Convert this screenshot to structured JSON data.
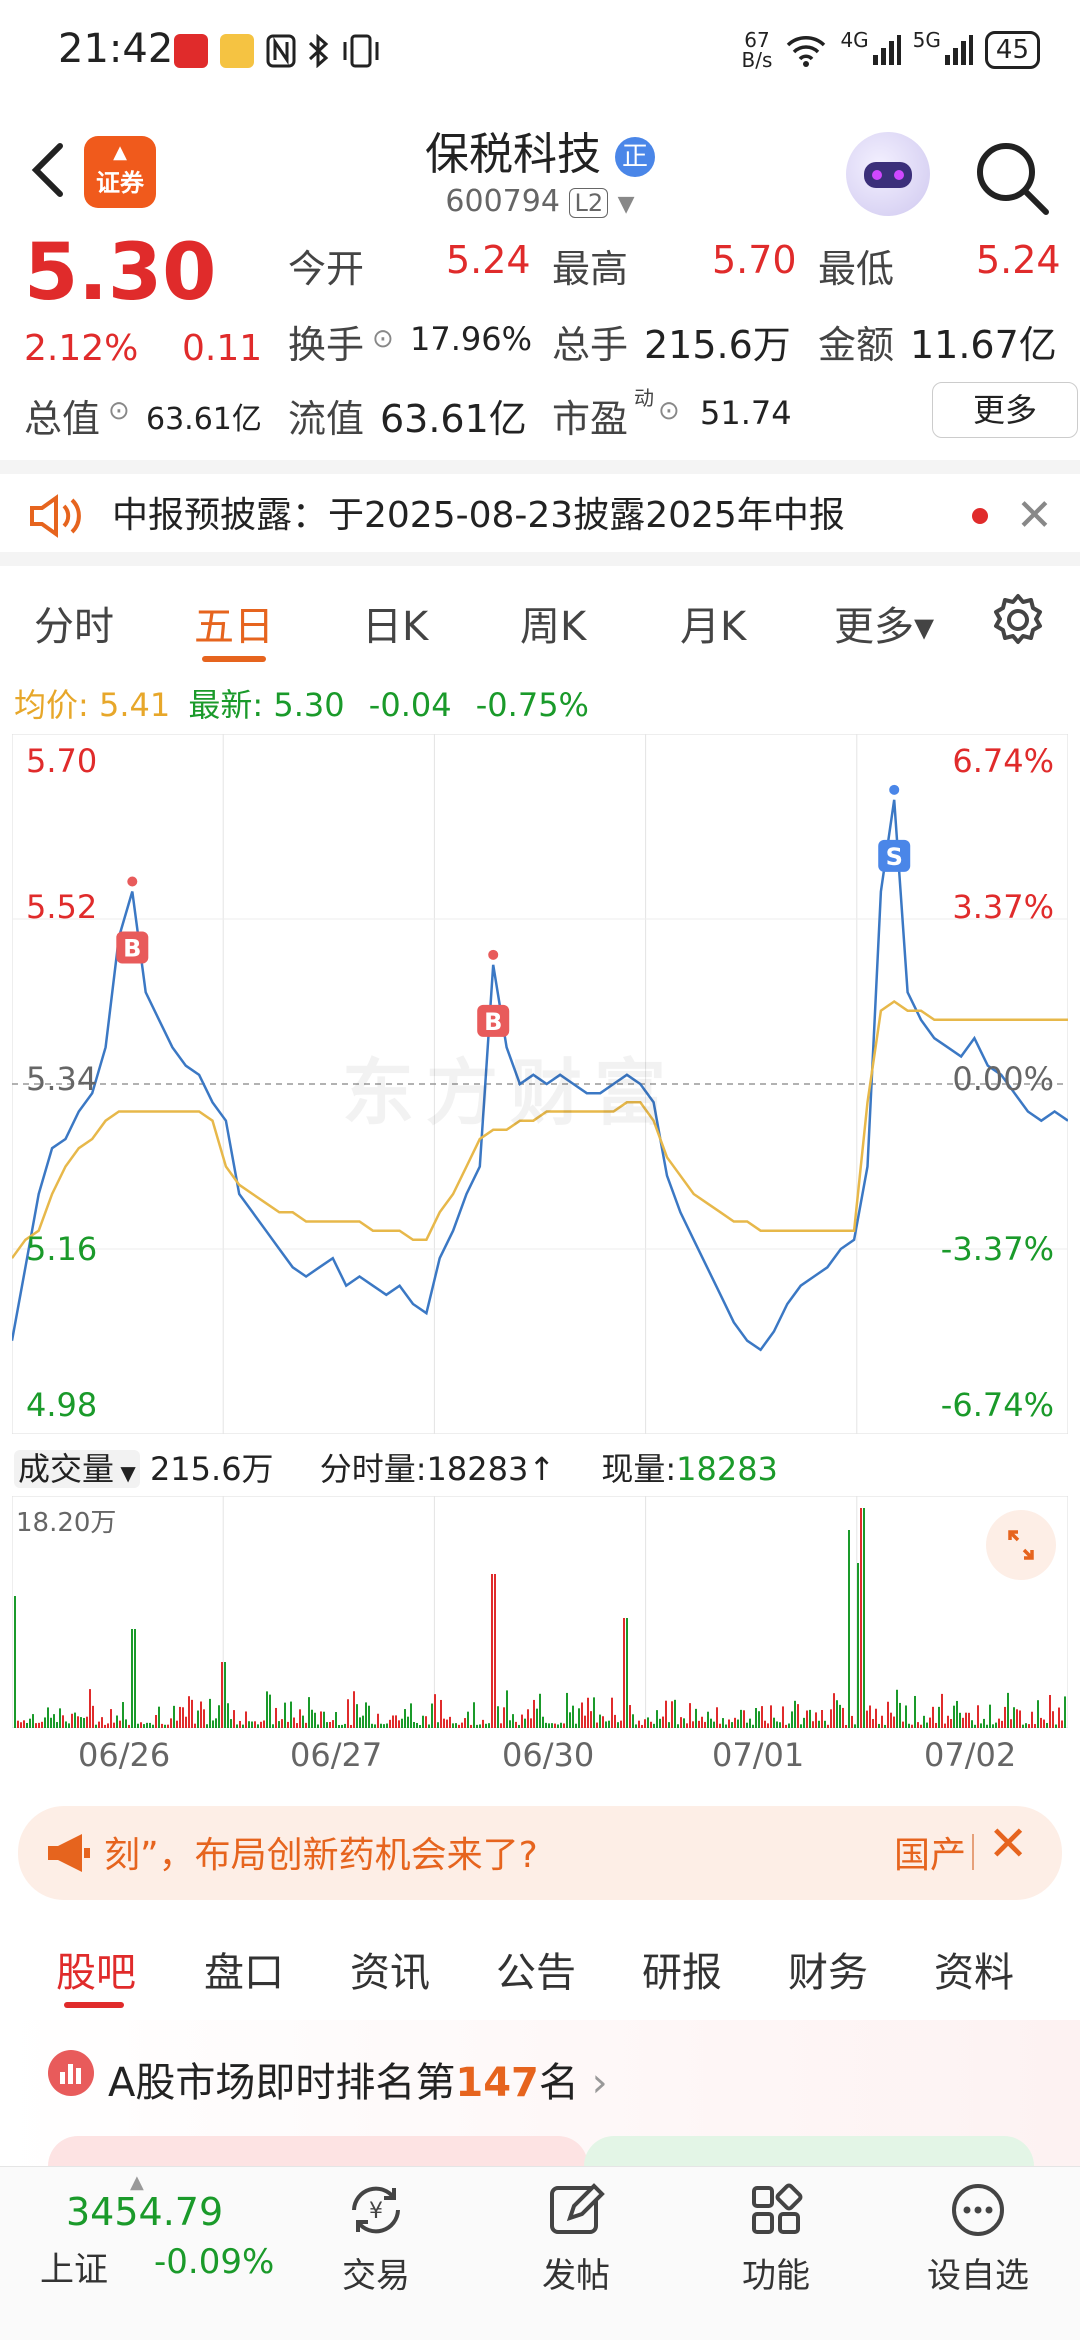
{
  "statusbar": {
    "time": "21:42",
    "speed_top": "67",
    "speed_bottom": "B/s",
    "net1": "4G",
    "net2": "5G",
    "battery": "45"
  },
  "header": {
    "logo_text": "证券",
    "title": "保税科技",
    "title_badge": "正",
    "code": "600794",
    "level": "L2"
  },
  "quote": {
    "price": "5.30",
    "pct": "2.12%",
    "chg": "0.11",
    "open_label": "今开",
    "open": "5.24",
    "high_label": "最高",
    "high": "5.70",
    "low_label": "最低",
    "low": "5.24",
    "turnover_label": "换手",
    "turnover": "17.96%",
    "vol_label": "总手",
    "vol": "215.6万",
    "amount_label": "金额",
    "amount": "11.67亿",
    "mktcap_label": "总值",
    "mktcap": "63.61亿",
    "float_label": "流值",
    "float": "63.61亿",
    "pe_label": "市盈",
    "pe_sup": "动",
    "pe": "51.74",
    "more": "更多"
  },
  "notice": {
    "text": "中报预披露：于2025-08-23披露2025年中报"
  },
  "chart_tabs": {
    "t1": "分时",
    "t2": "五日",
    "t3": "日K",
    "t4": "周K",
    "t5": "月K",
    "t6": "更多▾"
  },
  "infoline": {
    "avg_label": "均价:",
    "avg": "5.41",
    "last_label": "最新:",
    "last": "5.30",
    "chg": "-0.04",
    "pct": "-0.75%"
  },
  "chart_data": {
    "type": "line",
    "axes": {
      "left": [
        "5.70",
        "5.52",
        "5.34",
        "5.16",
        "4.98"
      ],
      "right": [
        "6.74%",
        "3.37%",
        "0.00%",
        "-3.37%",
        "-6.74%"
      ]
    },
    "ylim": [
      4.98,
      5.7
    ],
    "days": [
      "06/26",
      "06/27",
      "06/30",
      "07/01",
      "07/02"
    ],
    "series": [
      {
        "name": "最新",
        "color": "#3b78c4",
        "values": [
          5.06,
          5.14,
          5.22,
          5.27,
          5.28,
          5.31,
          5.33,
          5.38,
          5.5,
          5.55,
          5.44,
          5.41,
          5.38,
          5.36,
          5.35,
          5.32,
          5.3,
          5.22,
          5.2,
          5.18,
          5.16,
          5.14,
          5.13,
          5.14,
          5.15,
          5.12,
          5.13,
          5.12,
          5.11,
          5.12,
          5.1,
          5.09,
          5.15,
          5.18,
          5.22,
          5.25,
          5.47,
          5.38,
          5.34,
          5.35,
          5.34,
          5.35,
          5.34,
          5.33,
          5.33,
          5.34,
          5.35,
          5.34,
          5.32,
          5.24,
          5.2,
          5.17,
          5.14,
          5.11,
          5.08,
          5.06,
          5.05,
          5.07,
          5.1,
          5.12,
          5.13,
          5.14,
          5.16,
          5.17,
          5.25,
          5.55,
          5.65,
          5.44,
          5.41,
          5.39,
          5.38,
          5.37,
          5.39,
          5.36,
          5.35,
          5.33,
          5.31,
          5.3,
          5.31,
          5.3
        ]
      },
      {
        "name": "均价",
        "color": "#e7b84a",
        "values": [
          5.15,
          5.17,
          5.18,
          5.22,
          5.25,
          5.27,
          5.28,
          5.3,
          5.31,
          5.31,
          5.31,
          5.31,
          5.31,
          5.31,
          5.31,
          5.3,
          5.25,
          5.23,
          5.22,
          5.21,
          5.2,
          5.2,
          5.19,
          5.19,
          5.19,
          5.19,
          5.19,
          5.18,
          5.18,
          5.18,
          5.17,
          5.17,
          5.2,
          5.22,
          5.25,
          5.28,
          5.29,
          5.29,
          5.3,
          5.3,
          5.31,
          5.31,
          5.31,
          5.31,
          5.31,
          5.31,
          5.32,
          5.32,
          5.3,
          5.26,
          5.24,
          5.22,
          5.21,
          5.2,
          5.19,
          5.19,
          5.18,
          5.18,
          5.18,
          5.18,
          5.18,
          5.18,
          5.18,
          5.18,
          5.32,
          5.42,
          5.43,
          5.42,
          5.42,
          5.41,
          5.41,
          5.41,
          5.41,
          5.41,
          5.41,
          5.41,
          5.41,
          5.41,
          5.41,
          5.41
        ]
      }
    ],
    "markers": [
      {
        "label": "B",
        "day": 0
      },
      {
        "label": "B",
        "day": 2
      },
      {
        "label": "S",
        "day": 4
      }
    ],
    "watermark": "东方财富"
  },
  "volume": {
    "label": "成交量",
    "total": "215.6万",
    "minute_label": "分时量:",
    "minute": "18283",
    "now_label": "现量:",
    "now": "18283",
    "max": "18.20万"
  },
  "banner": {
    "text": "刻”，布局创新药机会来了?",
    "right": "国产"
  },
  "bottom_tabs": {
    "t1": "股吧",
    "t2": "盘口",
    "t3": "资讯",
    "t4": "公告",
    "t5": "研报",
    "t6": "财务",
    "t7": "资料"
  },
  "rank": {
    "prefix": "A股市场即时排名第",
    "num": "147",
    "suffix": "名"
  },
  "bottomnav": {
    "index_value": "3454.79",
    "index_label": "上证",
    "index_chg": "-0.09%",
    "trade": "交易",
    "post": "发帖",
    "func": "功能",
    "watch": "设自选"
  }
}
